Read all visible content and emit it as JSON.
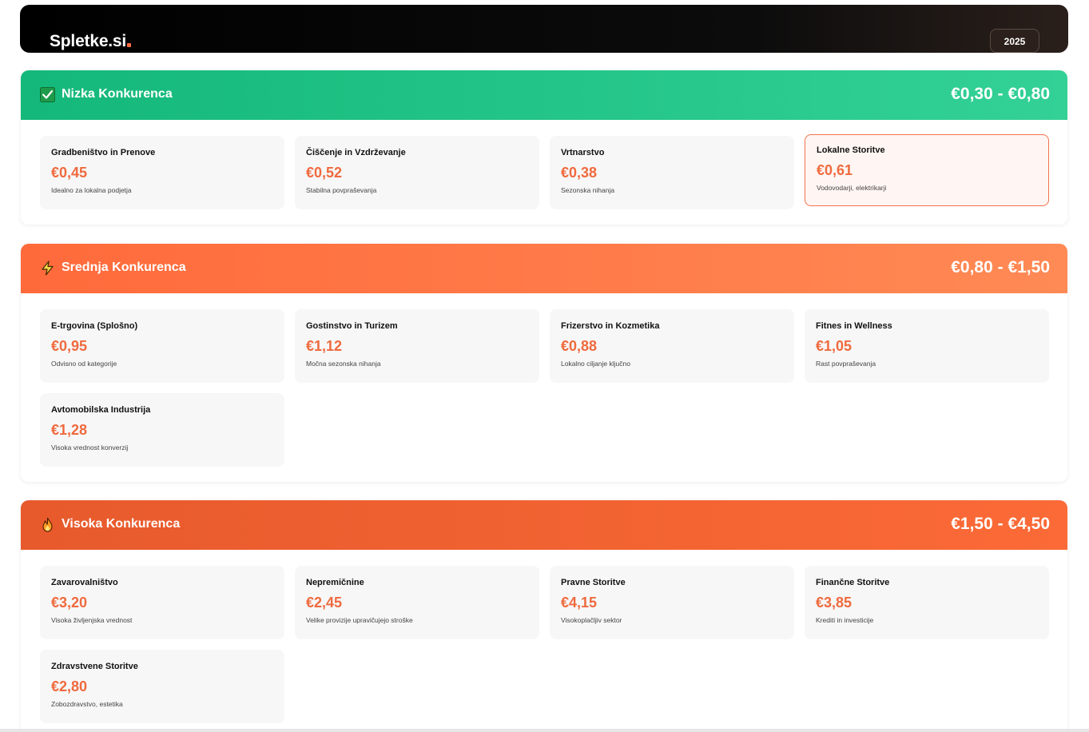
{
  "header": {
    "brand": "Spletke.si",
    "year": "2025"
  },
  "sections": [
    {
      "icon": "check-box-icon",
      "title": "Nizka Konkurenca",
      "range": "€0,30 - €0,80",
      "color_start": "#14b87a",
      "color_end": "#33d196",
      "items": [
        {
          "title": "Gradbeništvo in Prenove",
          "price": "€0,45",
          "note": "Idealno za lokalna podjetja"
        },
        {
          "title": "Čiščenje in Vzdrževanje",
          "price": "€0,52",
          "note": "Stabilna povpraševanja"
        },
        {
          "title": "Vrtnarstvo",
          "price": "€0,38",
          "note": "Sezonska nihanja"
        },
        {
          "title": "Lokalne Storitve",
          "price": "€0,61",
          "note": "Vodovodarji, elektrikarji"
        }
      ]
    },
    {
      "icon": "lightning-icon",
      "title": "Srednja Konkurenca",
      "range": "€0,80 - €1,50",
      "color_start": "#ff6a3b",
      "color_end": "#ff8a55",
      "items": [
        {
          "title": "E-trgovina (Splošno)",
          "price": "€0,95",
          "note": "Odvisno od kategorije"
        },
        {
          "title": "Gostinstvo in Turizem",
          "price": "€1,12",
          "note": "Močna sezonska nihanja"
        },
        {
          "title": "Frizerstvo in Kozmetika",
          "price": "€0,88",
          "note": "Lokalno ciljanje ključno"
        },
        {
          "title": "Fitnes in Wellness",
          "price": "€1,05",
          "note": "Rast povpraševanja"
        },
        {
          "title": "Avtomobilska Industrija",
          "price": "€1,28",
          "note": "Visoka vrednost konverzij"
        }
      ]
    },
    {
      "icon": "fire-icon",
      "title": "Visoka Konkurenca",
      "range": "€1,50 - €4,50",
      "color_start": "#e75a2c",
      "color_end": "#fb6a37",
      "items": [
        {
          "title": "Zavarovalništvo",
          "price": "€3,20",
          "note": "Visoka življenjska vrednost"
        },
        {
          "title": "Nepremičnine",
          "price": "€2,45",
          "note": "Velike provizije upravičujejo stroške"
        },
        {
          "title": "Pravne Storitve",
          "price": "€4,15",
          "note": "Visokoplačljiv sektor"
        },
        {
          "title": "Finančne Storitve",
          "price": "€3,85",
          "note": "Krediti in investicije"
        },
        {
          "title": "Zdravstvene Storitve",
          "price": "€2,80",
          "note": "Zobozdravstvo, estetika"
        }
      ]
    }
  ]
}
